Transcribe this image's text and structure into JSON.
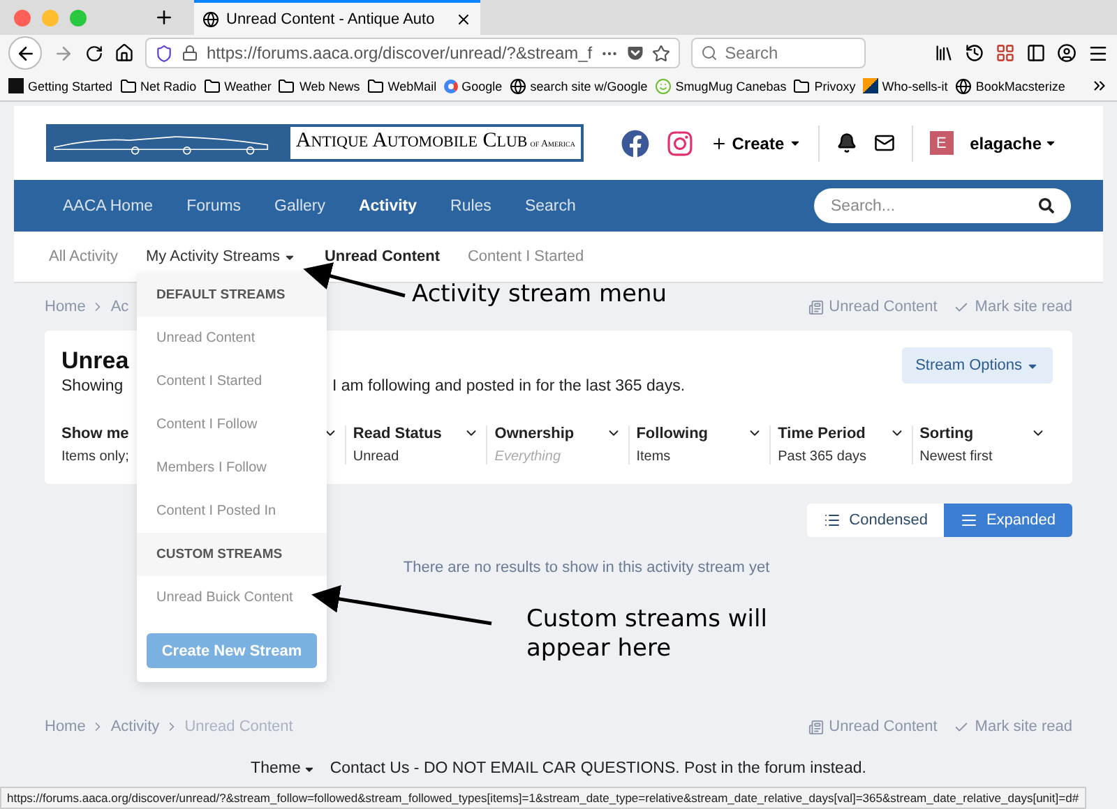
{
  "browser": {
    "tab_title": "Unread Content - Antique Auto",
    "url": "https://forums.aaca.org/discover/unread/?&stream_f",
    "search_placeholder": "Search",
    "bookmarks": [
      {
        "label": "Getting Started",
        "kind": "m"
      },
      {
        "label": "Net Radio",
        "kind": "folder"
      },
      {
        "label": "Weather",
        "kind": "folder"
      },
      {
        "label": "Web News",
        "kind": "folder"
      },
      {
        "label": "WebMail",
        "kind": "folder"
      },
      {
        "label": "Google",
        "kind": "google"
      },
      {
        "label": "search site w/Google",
        "kind": "globe"
      },
      {
        "label": "SmugMug Canebas",
        "kind": "smile"
      },
      {
        "label": "Privoxy",
        "kind": "folder"
      },
      {
        "label": "Who-sells-it",
        "kind": "square"
      },
      {
        "label": "BookMacsterize",
        "kind": "globe"
      }
    ],
    "status_url": "https://forums.aaca.org/discover/unread/?&stream_follow=followed&stream_followed_types[items]=1&stream_date_type=relative&stream_date_relative_days[val]=365&stream_date_relative_days[unit]=d#"
  },
  "site": {
    "logo_text": "Antique Automobile Club",
    "logo_subtext": "of America",
    "create": "Create",
    "user_initial": "E",
    "user_name": "elagache",
    "search_placeholder": "Search...",
    "nav": [
      {
        "label": "AACA Home",
        "selected": false
      },
      {
        "label": "Forums",
        "selected": false
      },
      {
        "label": "Gallery",
        "selected": false
      },
      {
        "label": "Activity",
        "selected": true
      },
      {
        "label": "Rules",
        "selected": false
      },
      {
        "label": "Search",
        "selected": false
      }
    ],
    "subnav": [
      {
        "label": "All Activity",
        "selected": false,
        "kind": "link"
      },
      {
        "label": "My Activity Streams",
        "selected": false,
        "kind": "menu"
      },
      {
        "label": "Unread Content",
        "selected": true,
        "kind": "link"
      },
      {
        "label": "Content I Started",
        "selected": false,
        "kind": "link"
      }
    ]
  },
  "page": {
    "breadcrumb": [
      "Home",
      "Ac"
    ],
    "actions": [
      "Unread Content",
      "Mark site read"
    ],
    "title": "Unrea",
    "description_start": "Showing",
    "description_end": "I am following and posted in for the last 365 days.",
    "stream_options": "Stream Options",
    "filters": [
      {
        "label": "Show me",
        "value": "Items only;",
        "muted": false
      },
      {
        "label": "Read Status",
        "value": "Unread",
        "muted": false
      },
      {
        "label": "Ownership",
        "value": "Everything",
        "muted": true
      },
      {
        "label": "Following",
        "value": "Items",
        "muted": false
      },
      {
        "label": "Time Period",
        "value": "Past 365 days",
        "muted": false
      },
      {
        "label": "Sorting",
        "value": "Newest first",
        "muted": false
      }
    ],
    "views": [
      {
        "label": "Condensed",
        "selected": false
      },
      {
        "label": "Expanded",
        "selected": true
      }
    ],
    "empty_message": "There are no results to show in this activity stream yet",
    "footer_breadcrumb": [
      "Home",
      "Activity",
      "Unread Content"
    ],
    "footer_actions": [
      "Unread Content",
      "Mark site read"
    ],
    "theme": "Theme",
    "contact": "Contact Us - DO NOT EMAIL CAR QUESTIONS. Post in the forum instead."
  },
  "menu": {
    "sections": [
      {
        "heading": "DEFAULT STREAMS",
        "items": [
          "Unread Content",
          "Content I Started",
          "Content I Follow",
          "Members I Follow",
          "Content I Posted In"
        ]
      },
      {
        "heading": "CUSTOM STREAMS",
        "items": [
          "Unread Buick Content"
        ]
      }
    ],
    "button": "Create New Stream"
  },
  "annotations": [
    {
      "text": "Activity stream menu"
    },
    {
      "text": "Custom streams will appear here"
    }
  ]
}
